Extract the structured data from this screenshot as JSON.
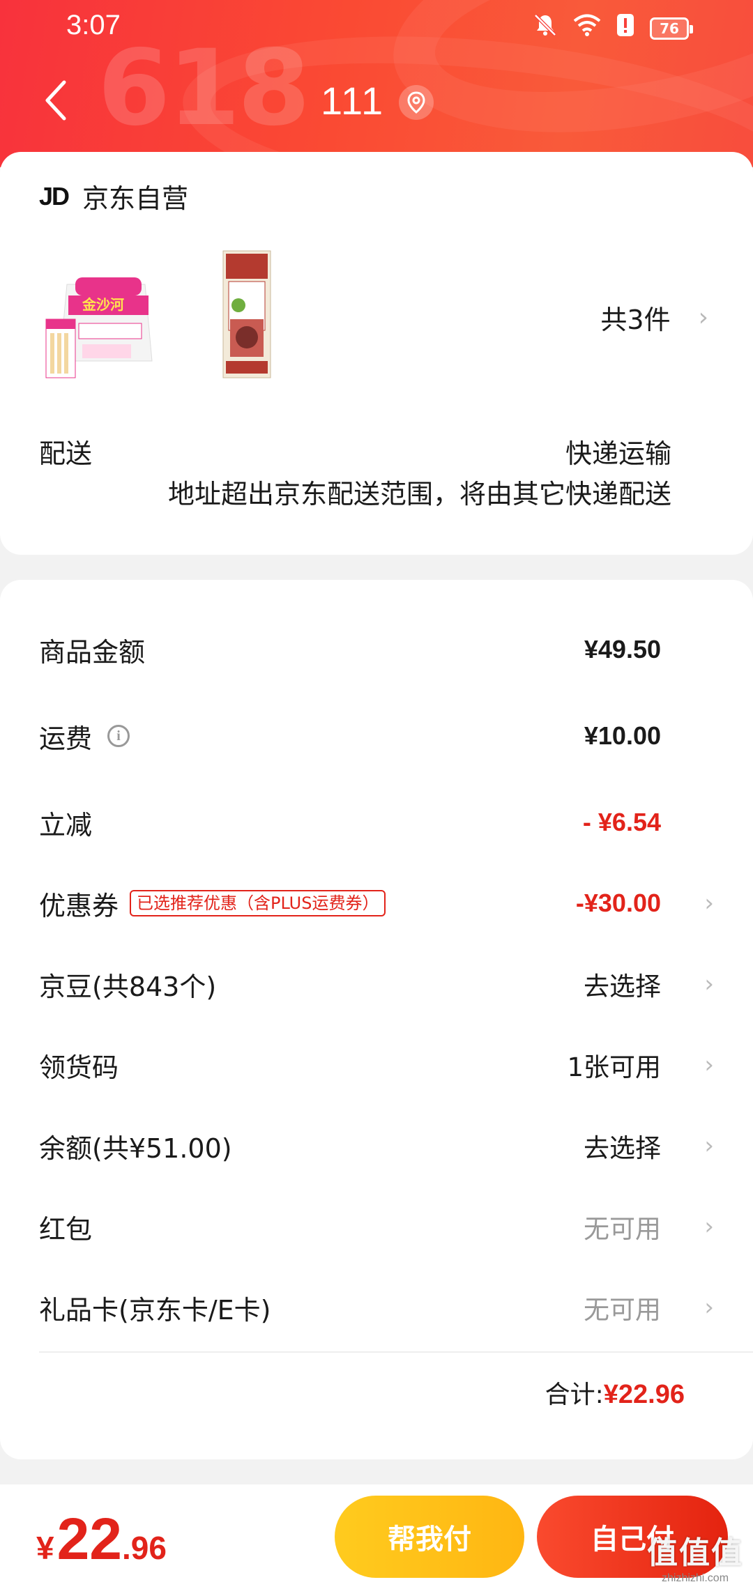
{
  "status_bar": {
    "time": "3:07",
    "battery": "76"
  },
  "header": {
    "title": "111",
    "background_text": "618"
  },
  "shop": {
    "logo_text": "JD",
    "name": "京东自营",
    "item_count": "共3件"
  },
  "delivery": {
    "label": "配送",
    "method": "快递运输",
    "note": "地址超出京东配送范围，将由其它快递配送"
  },
  "fees": {
    "goods_amount": {
      "label": "商品金额",
      "value": "¥49.50"
    },
    "shipping": {
      "label": "运费",
      "value": "¥10.00"
    },
    "discount": {
      "label": "立减",
      "value": "- ¥6.54"
    },
    "coupon": {
      "label": "优惠券",
      "tag": "已选推荐优惠（含PLUS运费券）",
      "value": "-¥30.00"
    },
    "jingdou": {
      "label": "京豆(共843个)",
      "value": "去选择"
    },
    "pickup_code": {
      "label": "领货码",
      "value": "1张可用"
    },
    "balance": {
      "label": "余额(共¥51.00)",
      "value": "去选择"
    },
    "red_packet": {
      "label": "红包",
      "value": "无可用"
    },
    "gift_card": {
      "label": "礼品卡(京东卡/E卡)",
      "value": "无可用"
    }
  },
  "total": {
    "label": "合计:",
    "value": "¥22.96"
  },
  "bottom_bar": {
    "currency": "¥",
    "price_int": "22",
    "price_dec": ".96",
    "help_pay_label": "帮我付",
    "self_pay_label": "自己付"
  },
  "watermark": {
    "main": "值值值",
    "sub": "zhizhizhi.com"
  },
  "colors": {
    "accent_red": "#e2231a",
    "help_yellow": "#ffc01a",
    "header_red": "#f8323c"
  }
}
